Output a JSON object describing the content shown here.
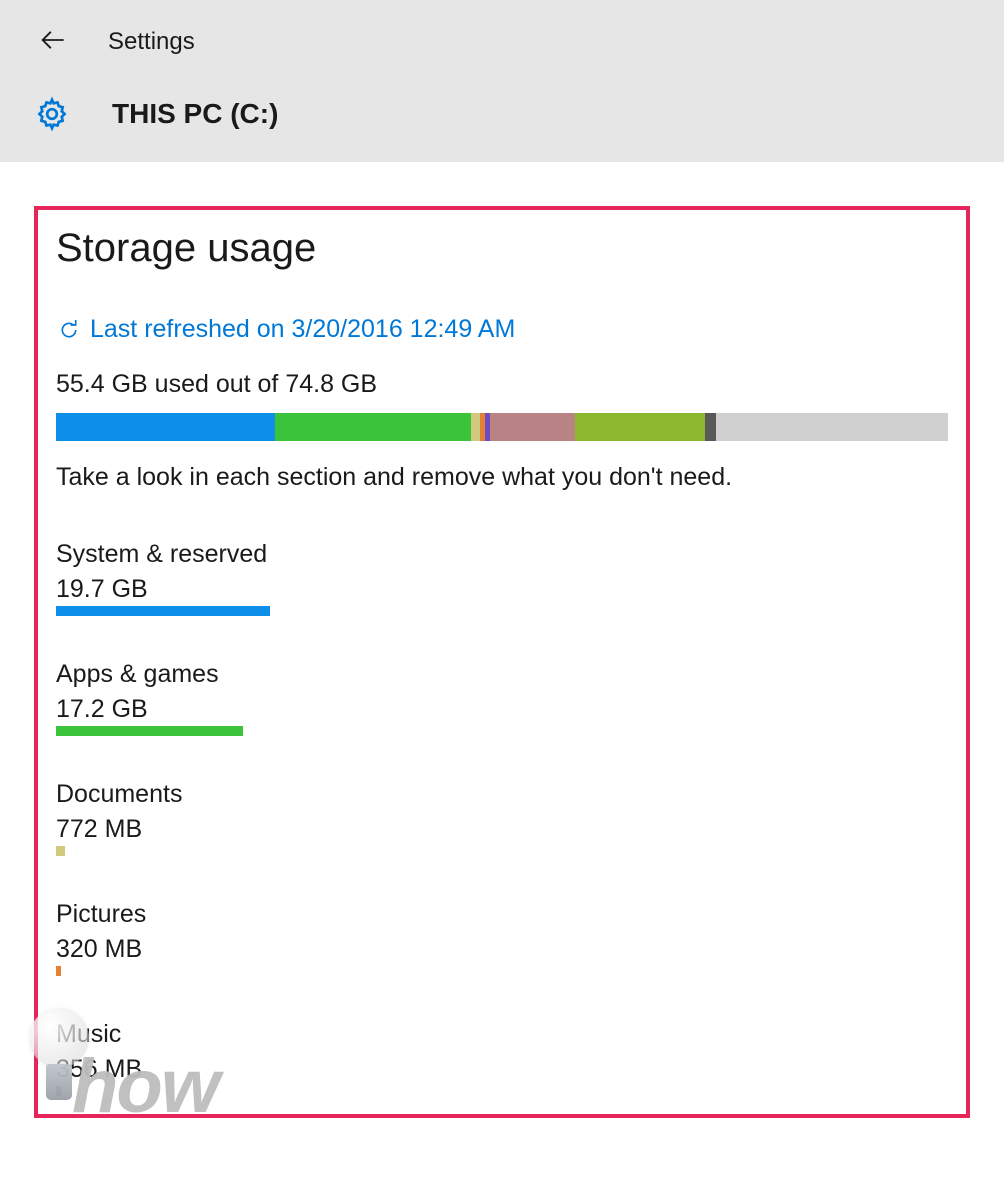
{
  "header": {
    "nav_title": "Settings",
    "drive_title": "THIS PC (C:)"
  },
  "page": {
    "title": "Storage usage",
    "refresh_label": "Last refreshed on 3/20/2016 12:49 AM",
    "usage_text": "55.4 GB used out of 74.8 GB",
    "hint": "Take a look in each section and remove what you don't need."
  },
  "total_gb": 74.8,
  "used_gb": 55.4,
  "bar_segments": [
    {
      "color": "#0d8ee8",
      "pct": 24.5
    },
    {
      "color": "#3cc33c",
      "pct": 22.0
    },
    {
      "color": "#d1c97d",
      "pct": 1.0
    },
    {
      "color": "#e68033",
      "pct": 0.6
    },
    {
      "color": "#6b4dbf",
      "pct": 0.6
    },
    {
      "color": "#b98285",
      "pct": 9.5
    },
    {
      "color": "#8db82e",
      "pct": 14.6
    },
    {
      "color": "#595959",
      "pct": 1.2
    },
    {
      "color": "#d0d0d0",
      "pct": 26.0
    }
  ],
  "categories": [
    {
      "name": "System & reserved",
      "size": "19.7 GB",
      "color": "#0d8ee8",
      "width_pct": 24
    },
    {
      "name": "Apps & games",
      "size": "17.2 GB",
      "color": "#3cc33c",
      "width_pct": 21
    },
    {
      "name": "Documents",
      "size": "772 MB",
      "color": "#d1c97d",
      "width_pct": 1.0
    },
    {
      "name": "Pictures",
      "size": "320 MB",
      "color": "#e68033",
      "width_pct": 0.6
    },
    {
      "name": "Music",
      "size": "356 MB",
      "color": "#6b4dbf",
      "width_pct": 0.6
    }
  ],
  "watermark": {
    "text": "how"
  }
}
